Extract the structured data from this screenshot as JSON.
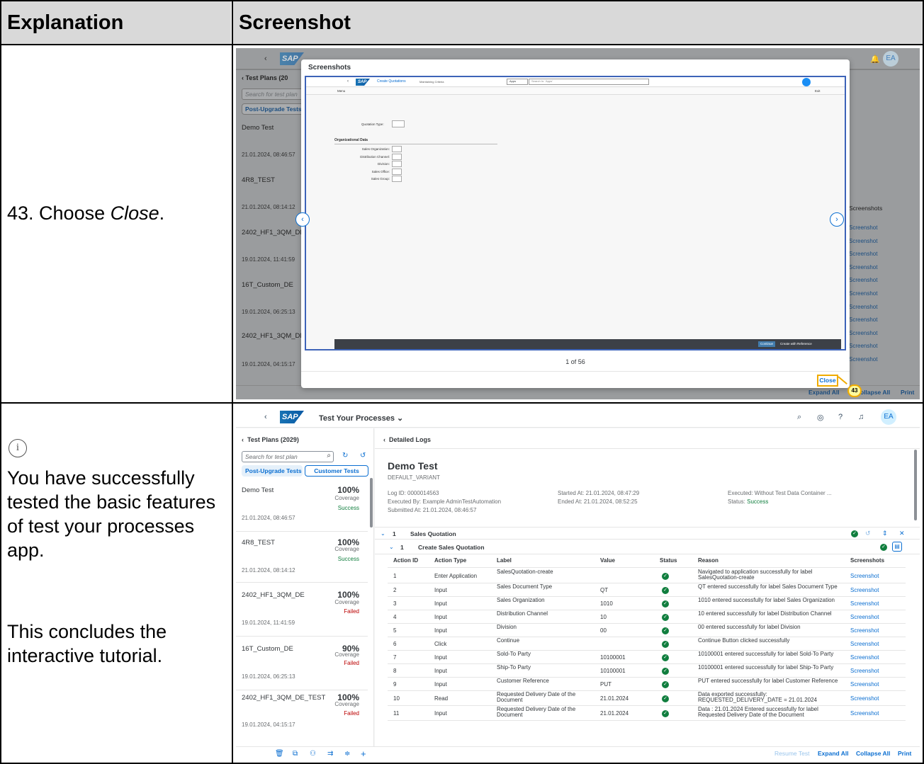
{
  "table": {
    "header_explanation": "Explanation",
    "header_screenshot": "Screenshot",
    "row1_text_prefix": "43. Choose ",
    "row1_text_em": "Close",
    "row1_text_suffix": ".",
    "row2_info_icon": "info-icon",
    "row2_paragraph1": "You have successfully tested the basic features of test your processes app.",
    "row2_paragraph2": "This concludes the interactive tutorial."
  },
  "app": {
    "title": "Test Your Processes",
    "title_short": "Test Your Processes",
    "avatar": "EA",
    "left_header": "Test Plans (2029)",
    "left_header_short": "Test Plans (20",
    "search_placeholder": "Search for test plan",
    "seg_post": "Post-Upgrade Tests",
    "seg_customer": "Customer Tests",
    "plans": [
      {
        "name": "Demo Test",
        "date": "21.01.2024, 08:46:57",
        "pct": "100%",
        "cov": "Coverage",
        "status": "Success"
      },
      {
        "name": "4R8_TEST",
        "date": "21.01.2024, 08:14:12",
        "pct": "100%",
        "cov": "Coverage",
        "status": "Success"
      },
      {
        "name": "2402_HF1_3QM_DE",
        "date": "19.01.2024, 11:41:59",
        "pct": "100%",
        "cov": "Coverage",
        "status": "Failed"
      },
      {
        "name": "16T_Custom_DE",
        "date": "19.01.2024, 06:25:13",
        "pct": "90%",
        "cov": "Coverage",
        "status": "Failed"
      },
      {
        "name": "2402_HF1_3QM_DE_TEST",
        "date": "19.01.2024, 04:15:17",
        "pct": "100%",
        "cov": "Coverage",
        "status": "Failed"
      }
    ],
    "plans_truncated": [
      "Demo Test",
      "4R8_TEST",
      "2402_HF1_3QM_DE",
      "16T_Custom_DE",
      "2402_HF1_3QM_DE"
    ],
    "detail_back": "Detailed Logs",
    "detail_title": "Demo Test",
    "detail_variant": "DEFAULT_VARIANT",
    "log_id": "Log ID: 0000014563",
    "executed_by": "Executed By: Example AdminTestAutomation",
    "submitted_at": "Submitted At: 21.01.2024, 08:46:57",
    "started_at": "Started At: 21.01.2024, 08:47:29",
    "ended_at": "Ended At: 21.01.2024, 08:52:25",
    "executed": "Executed: Without Test Data Container ...",
    "status_label": "Status: ",
    "status_value": "Success",
    "group1_num": "1",
    "group1_label": "Sales Quotation",
    "group2_num": "1",
    "group2_label": "Create Sales Quotation",
    "columns": [
      "Action ID",
      "Action Type",
      "Label",
      "Value",
      "Status",
      "Reason",
      "Screenshots"
    ],
    "rows": [
      {
        "id": "1",
        "type": "Enter Application",
        "label": "SalesQuotation-create",
        "value": "",
        "reason": "Navigated to application successfully for label SalesQuotation-create",
        "shot": "Screenshot"
      },
      {
        "id": "2",
        "type": "Input",
        "label": "Sales Document Type",
        "value": "QT",
        "reason": "QT entered successfully for label Sales Document Type",
        "shot": "Screenshot"
      },
      {
        "id": "3",
        "type": "Input",
        "label": "Sales Organization",
        "value": "1010",
        "reason": "1010 entered successfully for label Sales Organization",
        "shot": "Screenshot"
      },
      {
        "id": "4",
        "type": "Input",
        "label": "Distribution Channel",
        "value": "10",
        "reason": "10 entered successfully for label Distribution Channel",
        "shot": "Screenshot"
      },
      {
        "id": "5",
        "type": "Input",
        "label": "Division",
        "value": "00",
        "reason": "00 entered successfully for label Division",
        "shot": "Screenshot"
      },
      {
        "id": "6",
        "type": "Click",
        "label": "Continue",
        "value": "",
        "reason": "Continue Button clicked successfully",
        "shot": "Screenshot"
      },
      {
        "id": "7",
        "type": "Input",
        "label": "Sold-To Party",
        "value": "10100001",
        "reason": "10100001 entered successfully for label Sold-To Party",
        "shot": "Screenshot"
      },
      {
        "id": "8",
        "type": "Input",
        "label": "Ship-To Party",
        "value": "10100001",
        "reason": "10100001 entered successfully for label Ship-To Party",
        "shot": "Screenshot"
      },
      {
        "id": "9",
        "type": "Input",
        "label": "Customer Reference",
        "value": "PUT",
        "reason": "PUT entered successfully for label Customer Reference",
        "shot": "Screenshot"
      },
      {
        "id": "10",
        "type": "Read",
        "label": "Requested Delivery Date of the Document",
        "value": "21.01.2024",
        "reason": "Data exported successfully: REQUESTED_DELIVERY_DATE = 21.01.2024",
        "shot": "Screenshot"
      },
      {
        "id": "11",
        "type": "Input",
        "label": "Requested Delivery Date of the Document",
        "value": "21.01.2024",
        "reason": "Data : 21.01.2024 Entered successfully for label Requested Delivery Date of the Document",
        "shot": "Screenshot"
      }
    ],
    "footer_resume": "Resume Test",
    "footer_expand": "Expand All",
    "footer_collapse": "Collapse All",
    "footer_collapse_partial": "ollapse All",
    "footer_print": "Print",
    "right_col_header": "Screenshots",
    "right_col_link": "Screenshot"
  },
  "dialog": {
    "title": "Screenshots",
    "pager": "1 of 56",
    "close": "Close",
    "step_badge": "43",
    "inner_app_title": "Create Quotations",
    "inner_app_sub": "Maintaining Criteria",
    "inner_search_scope": "Apps",
    "inner_search_placeholder": "Search In: 'Apps'",
    "inner_menu": "Menu",
    "inner_exit": "Exit",
    "inner_field_qt": "Quotation Type:",
    "inner_section": "Organizational Data",
    "inner_fields": [
      "Sales Organization:",
      "Distribution Channel:",
      "Division:",
      "Sales Office:",
      "Sales Group:"
    ],
    "inner_continue": "Continue",
    "inner_create_ref": "Create with Reference"
  },
  "colors": {
    "accent": "#0a6ed1",
    "success": "#107e3e",
    "error": "#bb0000",
    "highlight": "#f0ab00"
  }
}
